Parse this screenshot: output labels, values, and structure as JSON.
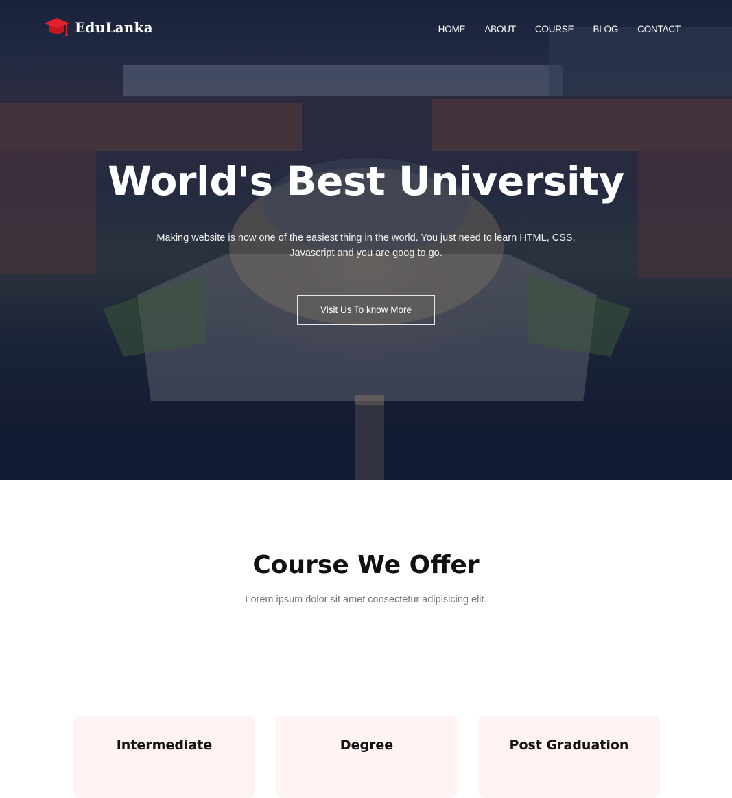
{
  "brand": {
    "name": "EduLanka",
    "icon": "graduation-cap-icon",
    "accent": "#e0202a"
  },
  "nav": {
    "items": [
      "HOME",
      "ABOUT",
      "COURSE",
      "BLOG",
      "CONTACT"
    ]
  },
  "hero": {
    "title": "World's Best University",
    "subtitle": "Making website is now one of the easiest thing in the world. You just need to learn HTML, CSS, Javascript and you are goog to go.",
    "button_label": "Visit Us To know More"
  },
  "courses": {
    "title": "Course We Offer",
    "subtitle": "Lorem ipsum dolor sit amet consectetur adipisicing elit.",
    "cards": [
      {
        "title": "Intermediate"
      },
      {
        "title": "Degree"
      },
      {
        "title": "Post Graduation"
      }
    ],
    "card_color": "#fff3f3"
  }
}
